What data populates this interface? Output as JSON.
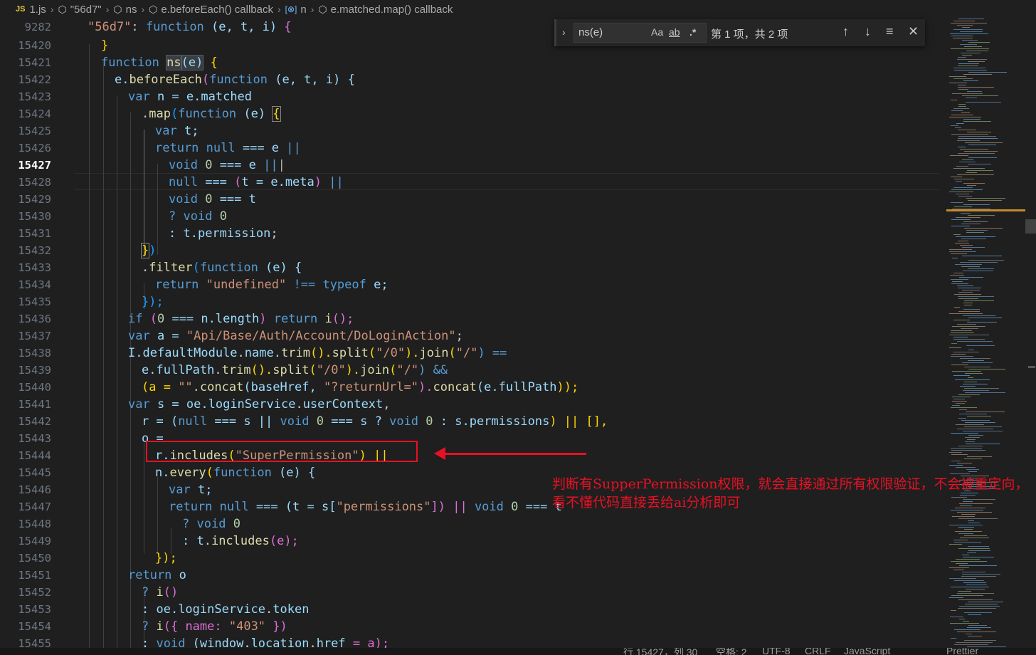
{
  "breadcrumb": {
    "file": "1.js",
    "file_icon": "JS",
    "items": [
      "\"56d7\"",
      "ns",
      "e.beforeEach() callback",
      "n",
      "e.matched.map() callback"
    ]
  },
  "find_widget": {
    "query": "ns(e)",
    "match_case_label": "Aa",
    "whole_word_label": "ab",
    "regex_label": ".*",
    "count": "第 1 项，共 2 项"
  },
  "editor": {
    "active_line": "15427",
    "line_numbers": [
      "9282",
      "15420",
      "15421",
      "15422",
      "15423",
      "15424",
      "15425",
      "15426",
      "15427",
      "15428",
      "15429",
      "15430",
      "15431",
      "15432",
      "15433",
      "15434",
      "15435",
      "15436",
      "15437",
      "15438",
      "15439",
      "15440",
      "15441",
      "15442",
      "15443",
      "15444",
      "15445",
      "15446",
      "15447",
      "15448",
      "15449",
      "15450",
      "15451",
      "15452",
      "15453",
      "15454",
      "15455"
    ],
    "tokens": {
      "l0": [
        "\"56d7\"",
        ": ",
        "function",
        " (e, t, i) ",
        "{"
      ],
      "l1": [
        "}"
      ],
      "l2": [
        "function",
        " ",
        "ns",
        "(e)",
        " {"
      ],
      "l3": [
        "e.",
        "beforeEach",
        "(",
        "function",
        " (e, t, i) {"
      ],
      "l4": [
        "var",
        " n = e.",
        "matched"
      ],
      "l5": [
        ".",
        "map",
        "(",
        "function",
        " (e) ",
        "{"
      ],
      "l6": [
        "var",
        " t;"
      ],
      "l7": [
        "return",
        " ",
        "null",
        " === e ",
        "||"
      ],
      "l8": [
        "void",
        " ",
        "0",
        " === e ",
        "||"
      ],
      "l9": [
        "null",
        " === ",
        "(",
        "t = e.",
        "meta",
        ")",
        " ",
        "||"
      ],
      "l10": [
        "void",
        " ",
        "0",
        " === t"
      ],
      "l11": [
        "? ",
        "void",
        " ",
        "0"
      ],
      "l12": [
        ": t.",
        "permission",
        ";"
      ],
      "l13": [
        "}",
        ")"
      ],
      "l14": [
        ".",
        "filter",
        "(",
        "function",
        " (e) {"
      ],
      "l15": [
        "return",
        " ",
        "\"undefined\"",
        " !== ",
        "typeof",
        " e;"
      ],
      "l16": [
        "});"
      ],
      "l17": [
        "if",
        " (",
        "0",
        " === n.",
        "length",
        ") ",
        "return",
        " ",
        "i",
        "();"
      ],
      "l18": [
        "var",
        " a = ",
        "\"Api/Base/Auth/Account/DoLoginAction\"",
        ";"
      ],
      "l19": [
        "I.",
        "defaultModule",
        ".",
        "name",
        ".",
        "trim",
        "().",
        "split",
        "(",
        "\"/0\"",
        ").",
        "join",
        "(",
        "\"/\"",
        ") =="
      ],
      "l20": [
        "e.",
        "fullPath",
        ".",
        "trim",
        "().",
        "split",
        "(",
        "\"/0\"",
        ").",
        "join",
        "(",
        "\"/\"",
        ") &&"
      ],
      "l21": [
        "(a = ",
        "\"\"",
        ".",
        "concat",
        "(baseHref, ",
        "\"?returnUrl=\"",
        ").",
        "concat",
        "(e.",
        "fullPath",
        "));"
      ],
      "l22": [
        "var",
        " s = oe.",
        "loginService",
        ".",
        "userContext",
        ","
      ],
      "l23": [
        "r = (",
        "null",
        " === s || ",
        "void",
        " ",
        "0",
        " === s ? ",
        "void",
        " ",
        "0",
        " : s.",
        "permissions",
        ") || [],"
      ],
      "l24": [
        "o ="
      ],
      "l25": [
        "r.",
        "includes",
        "(",
        "\"SuperPermission\"",
        ") ||"
      ],
      "l26": [
        "n.",
        "every",
        "(",
        "function",
        " (e) {"
      ],
      "l27": [
        "var",
        " t;"
      ],
      "l28": [
        "return",
        " ",
        "null",
        " === (t = s[",
        "\"permissions\"",
        "]) || ",
        "void",
        " ",
        "0",
        " === t"
      ],
      "l29": [
        "? ",
        "void",
        " ",
        "0"
      ],
      "l30": [
        ": t.",
        "includes",
        "(e);"
      ],
      "l31": [
        "});"
      ],
      "l32": [
        "return",
        " o"
      ],
      "l33": [
        "? ",
        "i",
        "()"
      ],
      "l34": [
        ": oe.",
        "loginService",
        ".",
        "token"
      ],
      "l35": [
        "? ",
        "i",
        "({ name: ",
        "\"403\"",
        " })"
      ],
      "l36": [
        ": ",
        "void",
        " (window.",
        "location",
        ".",
        "href",
        " = a);"
      ]
    }
  },
  "annotation": {
    "text": "判断有SupperPermission权限，就会直接通过所有权限验证，不会被重定向，看不懂代码直接丢给ai分析即可",
    "color": "#e81123"
  },
  "statusbar": {
    "position": "行 15427，列 30",
    "indent": "空格: 2",
    "encoding": "UTF-8",
    "eol": "CRLF",
    "language": "JavaScript",
    "formatter": "Prettier"
  },
  "colors": {
    "background": "#1f1f1f",
    "keyword": "#569cd6",
    "function": "#dcdcaa",
    "string": "#ce9178",
    "number": "#b5cea8",
    "annotation": "#e81123"
  }
}
